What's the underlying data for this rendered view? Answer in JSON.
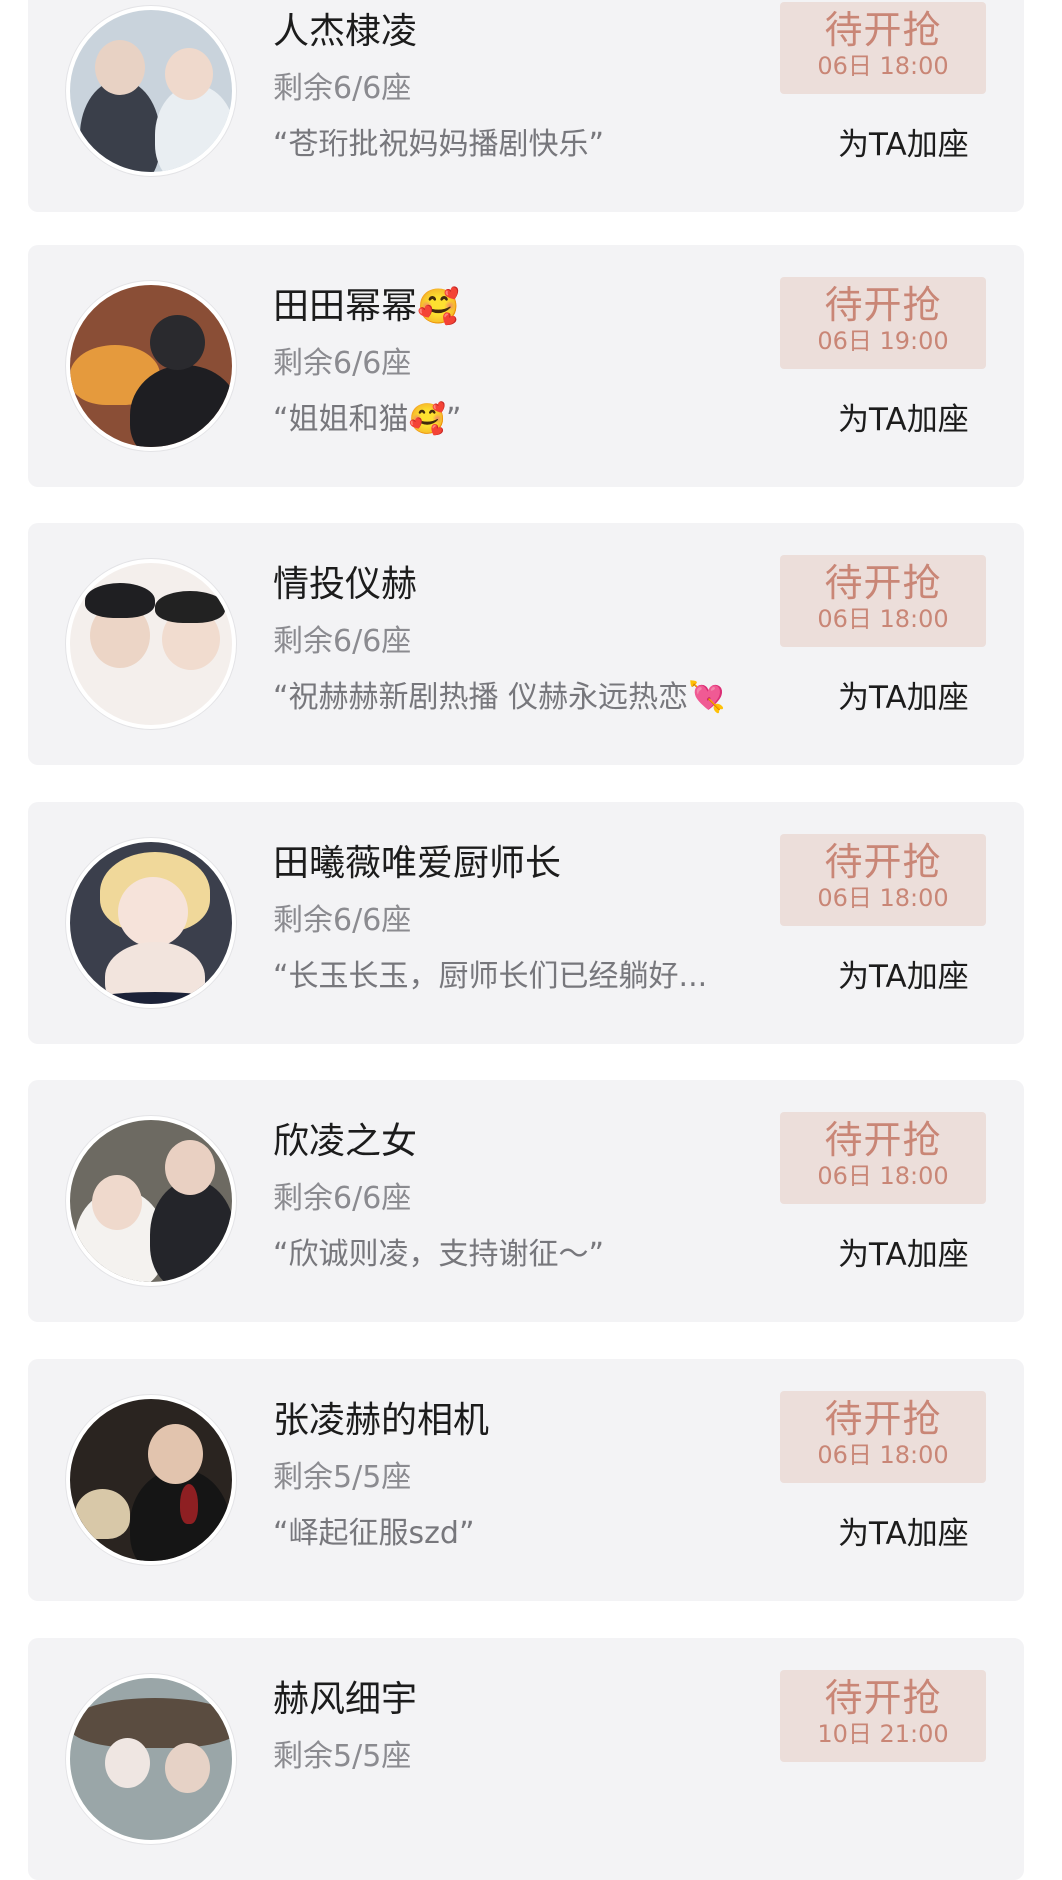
{
  "add_label": "为TA加座",
  "badge_status": "待开抢",
  "cards": [
    {
      "name": "人杰棣凌",
      "seats": "剩余6/6座",
      "message": "“苍珩批祝妈妈播剧快乐”",
      "time": "06日 18:00"
    },
    {
      "name": "田田幂幂",
      "name_emoji": "🥰",
      "seats": "剩余6/6座",
      "message": "“姐姐和猫🥰”",
      "time": "06日 19:00"
    },
    {
      "name": "情投仪赫",
      "seats": "剩余6/6座",
      "message": "“祝赫赫新剧热播 仪赫永远热恋💘",
      "time": "06日 18:00"
    },
    {
      "name": "田曦薇唯爱厨师长",
      "seats": "剩余6/6座",
      "message": "“长玉长玉，厨师长们已经躺好...",
      "time": "06日 18:00"
    },
    {
      "name": "欣凌之女",
      "seats": "剩余6/6座",
      "message": "“欣诚则凌，支持谢征～”",
      "time": "06日 18:00"
    },
    {
      "name": "张凌赫的相机",
      "seats": "剩余5/5座",
      "message": "“峄起征服szd”",
      "time": "06日 18:00"
    },
    {
      "name": "赫风细宇",
      "seats": "剩余5/5座",
      "message": "",
      "time": "10日 21:00"
    }
  ]
}
